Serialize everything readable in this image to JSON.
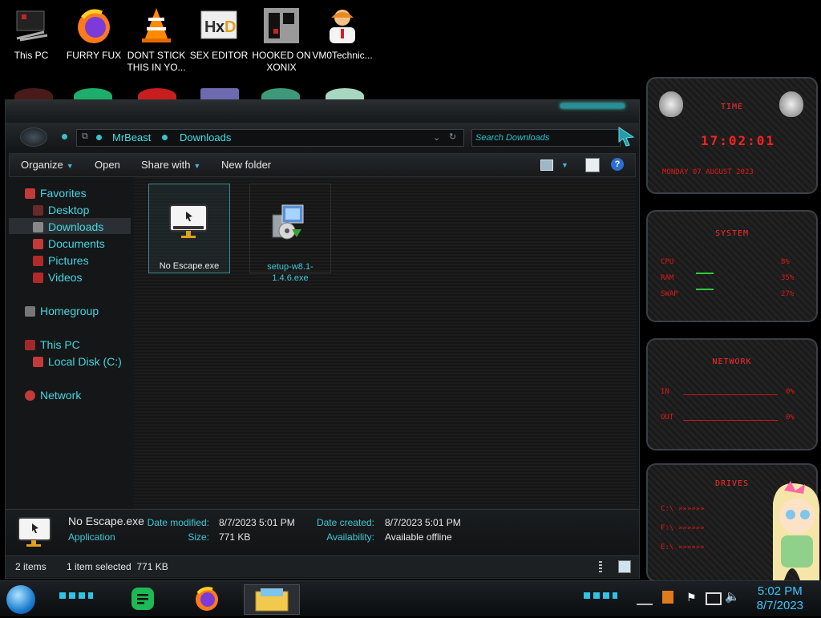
{
  "desktop": {
    "icons": [
      {
        "label": "This PC"
      },
      {
        "label": "FURRY FUX"
      },
      {
        "label": "DONT STICK THIS IN YO..."
      },
      {
        "label": "SEX EDITOR"
      },
      {
        "label": "HOOKED ON XONIX"
      },
      {
        "label": "VM0Technic..."
      }
    ]
  },
  "explorer": {
    "breadcrumb": [
      "MrBeast",
      "Downloads"
    ],
    "search_placeholder": "Search Downloads",
    "toolbar": {
      "organize": "Organize",
      "open": "Open",
      "share_with": "Share with",
      "new_folder": "New folder"
    },
    "nav": {
      "favorites": "Favorites",
      "desktop": "Desktop",
      "downloads": "Downloads",
      "documents": "Documents",
      "pictures": "Pictures",
      "videos": "Videos",
      "homegroup": "Homegroup",
      "this_pc": "This PC",
      "local_disk": "Local Disk (C:)",
      "network": "Network"
    },
    "files": [
      {
        "name": "No Escape.exe",
        "selected": true
      },
      {
        "name": "setup-w8.1-1.4.6.exe",
        "selected": false
      }
    ],
    "details": {
      "name": "No Escape.exe",
      "type": "Application",
      "date_modified_label": "Date modified:",
      "date_modified": "8/7/2023 5:01 PM",
      "size_label": "Size:",
      "size": "771 KB",
      "date_created_label": "Date created:",
      "date_created": "8/7/2023 5:01 PM",
      "availability_label": "Availability:",
      "availability": "Available offline"
    },
    "status": {
      "items": "2 items",
      "selected": "1 item selected  771 KB"
    }
  },
  "gadgets": {
    "time": {
      "title": "TIME",
      "clock": "17:02:01",
      "date": "MONDAY 07 AUGUST 2023"
    },
    "system": {
      "title": "SYSTEM",
      "rows": [
        {
          "label": "CPU",
          "value": "8%"
        },
        {
          "label": "RAM",
          "value": "35%"
        },
        {
          "label": "SWAP",
          "value": "27%"
        }
      ]
    },
    "network": {
      "title": "NETWORK",
      "rows": [
        {
          "label": "IN",
          "value": "0%"
        },
        {
          "label": "OUT",
          "value": "0%"
        }
      ]
    },
    "drives": {
      "title": "DRIVES",
      "rows": [
        {
          "label": "C:\\",
          "bar": "»»»»»»"
        },
        {
          "label": "F:\\",
          "bar": "»»»»»»"
        },
        {
          "label": "E:\\",
          "bar": "»»»»»»"
        }
      ]
    }
  },
  "taskbar": {
    "time": "5:02 PM",
    "date": "8/7/2023"
  },
  "colors": {
    "accent": "#3fe0e6",
    "gadget_red": "#e01818",
    "clock_blue": "#3ac8ff"
  }
}
